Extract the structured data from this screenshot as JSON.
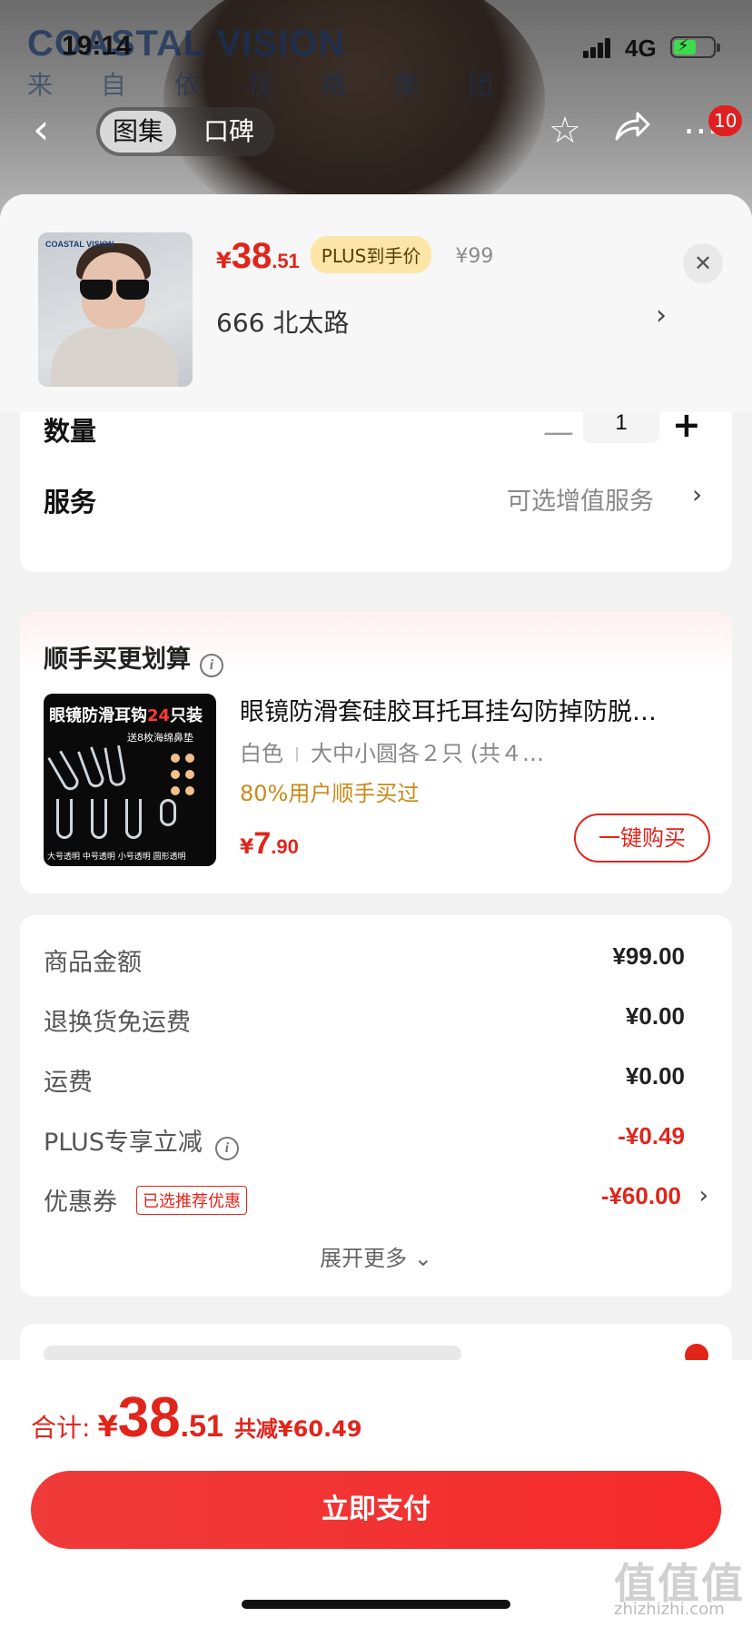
{
  "status": {
    "time": "19:14",
    "network": "4G"
  },
  "hero": {
    "brand": "COASTAL VISION",
    "brand_sub": "来 自 依 视 路 集 团"
  },
  "nav": {
    "tabs": [
      "图集",
      "口碑"
    ],
    "cart_count": "10"
  },
  "product": {
    "currency": "¥",
    "price_int": "38",
    "price_dec": ".51",
    "plus_tag": "PLUS到手价",
    "original_price": "¥99",
    "spec": "666  北太路",
    "thumb_brand": "COASTAL VISION"
  },
  "options": {
    "quantity_label": "数量",
    "quantity": "1",
    "service_label": "服务",
    "service_value": "可选增值服务"
  },
  "addon": {
    "section_title": "顺手买更划算",
    "image_title_a": "眼镜防滑耳钩",
    "image_title_b": "24",
    "image_title_c": "只装",
    "image_sub": "送8枚海绵鼻垫",
    "image_caption": "大号透明  中号透明  小号透明  圆形透明",
    "title": "眼镜防滑套硅胶耳托耳挂勾防掉防脱…",
    "color": "白色",
    "size": "大中小圆各２只 (共４…",
    "buyers": "80%用户顺手买过",
    "currency": "¥",
    "price_int": "7",
    "price_dec": ".90",
    "buy_label": "一键购买"
  },
  "fees": {
    "rows": [
      {
        "label": "商品金额",
        "value": "¥99.00"
      },
      {
        "label": "退换货免运费",
        "value": "¥0.00"
      },
      {
        "label": "运费",
        "value": "¥0.00"
      },
      {
        "label": "PLUS专享立减",
        "value": "-¥0.49"
      },
      {
        "label": "优惠券",
        "value": "-¥60.00",
        "tag": "已选推荐优惠"
      }
    ],
    "expand_label": "展开更多"
  },
  "footer": {
    "total_label": "合计:",
    "currency": "¥",
    "total_int": "38",
    "total_dec": ".51",
    "saving": "共减¥60.49",
    "pay_label": "立即支付"
  },
  "watermark": {
    "logo": "值值值",
    "site": "zhizhizhi.com"
  },
  "colors": {
    "accent": "#e1251b",
    "plus_tag_bg": "#fbe6a8",
    "buyers_text": "#c98a1a"
  }
}
